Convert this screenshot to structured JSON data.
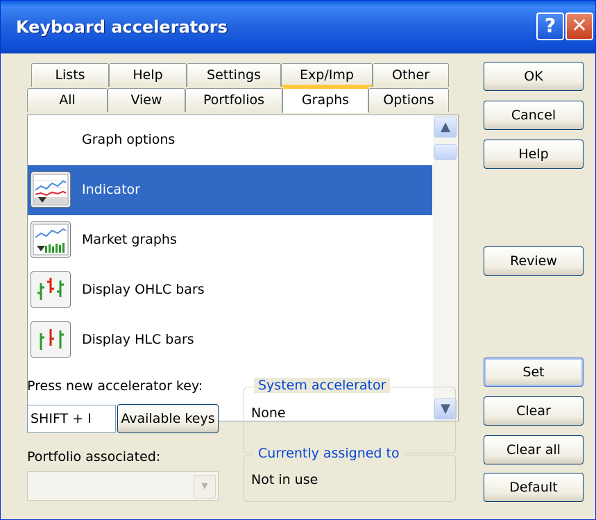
{
  "window": {
    "title": "Keyboard accelerators",
    "help_glyph": "?",
    "close_glyph": "✕"
  },
  "tabs": {
    "row1": [
      "Lists",
      "Help",
      "Settings",
      "Exp/Imp",
      "Other"
    ],
    "row2": [
      "All",
      "View",
      "Portfolios",
      "Graphs",
      "Options"
    ],
    "active": "Graphs"
  },
  "list": {
    "items": [
      {
        "label": "Graph options",
        "icon": "none",
        "selected": false
      },
      {
        "label": "Indicator",
        "icon": "indicator-graph-icon",
        "selected": true
      },
      {
        "label": "Market graphs",
        "icon": "market-graph-icon",
        "selected": false
      },
      {
        "label": "Display OHLC bars",
        "icon": "ohlc-bars-icon",
        "selected": false
      },
      {
        "label": "Display HLC bars",
        "icon": "hlc-bars-icon",
        "selected": false
      }
    ],
    "scroll_up": "▲",
    "scroll_down": "▼"
  },
  "buttons": {
    "ok": "OK",
    "cancel": "Cancel",
    "help": "Help",
    "review": "Review",
    "set": "Set",
    "clear": "Clear",
    "clear_all": "Clear all",
    "default": "Default",
    "available_keys": "Available keys"
  },
  "accelerator": {
    "label": "Press new accelerator key:",
    "value": "SHIFT + I"
  },
  "portfolio": {
    "label": "Portfolio associated:",
    "value": "",
    "dropdown_glyph": "▾"
  },
  "system_accelerator": {
    "title": "System accelerator",
    "value": "None"
  },
  "currently_assigned": {
    "title": "Currently assigned to",
    "value": "Not in use"
  },
  "colors": {
    "title_bar": "#2565e0",
    "selection": "#316ac5",
    "group_title": "#0046d5",
    "tab_highlight": "#ffc83c"
  }
}
